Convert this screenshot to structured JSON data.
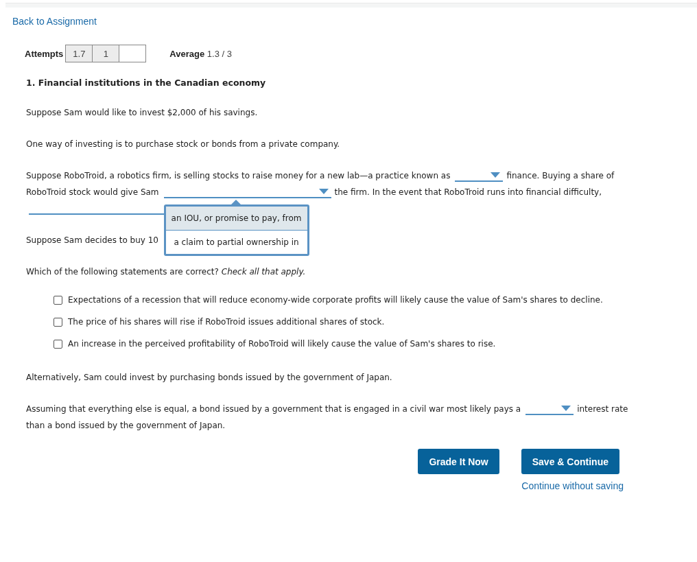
{
  "back_link": "Back to Assignment",
  "attempts": {
    "label": "Attempts",
    "scores": [
      {
        "text": "1.7",
        "used": true
      },
      {
        "text": "1",
        "used": true
      },
      {
        "used": false
      }
    ],
    "average_label": "Average",
    "average": "1.3 / 3"
  },
  "title": "1. Financial institutions in the Canadian economy",
  "blocks": [
    {
      "kind": "paragraph",
      "lines": [
        [
          {
            "kind": "text",
            "text": "Suppose Sam would like to invest $2,000 of his savings."
          }
        ]
      ]
    },
    {
      "kind": "paragraph",
      "lines": [
        [
          {
            "kind": "text",
            "text": "One way of investing is to purchase stock or bonds from a private company."
          }
        ]
      ]
    },
    {
      "kind": "paragraph",
      "lines": [
        [
          {
            "kind": "text",
            "text": "Suppose RoboTroid, a robotics firm, is selling stocks to raise money for a new lab—a practice known as"
          },
          {
            "kind": "short_dropdown"
          },
          {
            "kind": "text",
            "text": "finance. Buying a share of"
          }
        ],
        [
          {
            "kind": "text",
            "text": "RoboTroid stock would give Sam"
          },
          {
            "kind": "long_dropdown",
            "expanded": true,
            "options": [
              {
                "text": "an IOU, or promise to pay, from",
                "highlighted": true
              },
              {
                "text": "a claim to partial ownership in",
                "highlighted": false
              }
            ]
          },
          {
            "kind": "text",
            "text": "the firm. In the event that RoboTroid runs into financial difficulty,"
          }
        ],
        [
          {
            "kind": "long_dropdown"
          }
        ]
      ]
    },
    {
      "kind": "paragraph",
      "lines": [
        [
          {
            "kind": "text",
            "text": "Suppose Sam decides to buy 10"
          }
        ]
      ]
    },
    {
      "kind": "paragraph",
      "lines": [
        [
          {
            "kind": "text",
            "text": "Which of the following statements are correct? *Check all that apply.*"
          }
        ]
      ]
    },
    {
      "kind": "checklist",
      "items": [
        {
          "text": "Expectations of a recession that will reduce economy-wide corporate profits will likely cause the value of Sam's shares to decline.",
          "checked": false
        },
        {
          "text": "The price of his shares will rise if RoboTroid issues additional shares of stock.",
          "checked": false
        },
        {
          "text": "An increase in the perceived profitability of RoboTroid will likely cause the value of Sam's shares to rise.",
          "checked": false
        }
      ]
    },
    {
      "kind": "paragraph",
      "lines": [
        [
          {
            "kind": "text",
            "text": "Alternatively, Sam could invest by purchasing bonds issued by the government of Japan."
          }
        ]
      ]
    },
    {
      "kind": "paragraph",
      "lines": [
        [
          {
            "kind": "text",
            "text": "Assuming that everything else is equal, a bond issued by a government that is engaged in a civil war most likely pays a"
          },
          {
            "kind": "short_dropdown"
          },
          {
            "kind": "text",
            "text": "interest rate"
          }
        ],
        [
          {
            "kind": "text",
            "text": "than a bond issued by the government of Japan."
          }
        ]
      ]
    }
  ],
  "buttons": [
    {
      "text": "Grade It Now"
    },
    {
      "text": "Save & Continue"
    }
  ],
  "secondary_link": "Continue without saving"
}
